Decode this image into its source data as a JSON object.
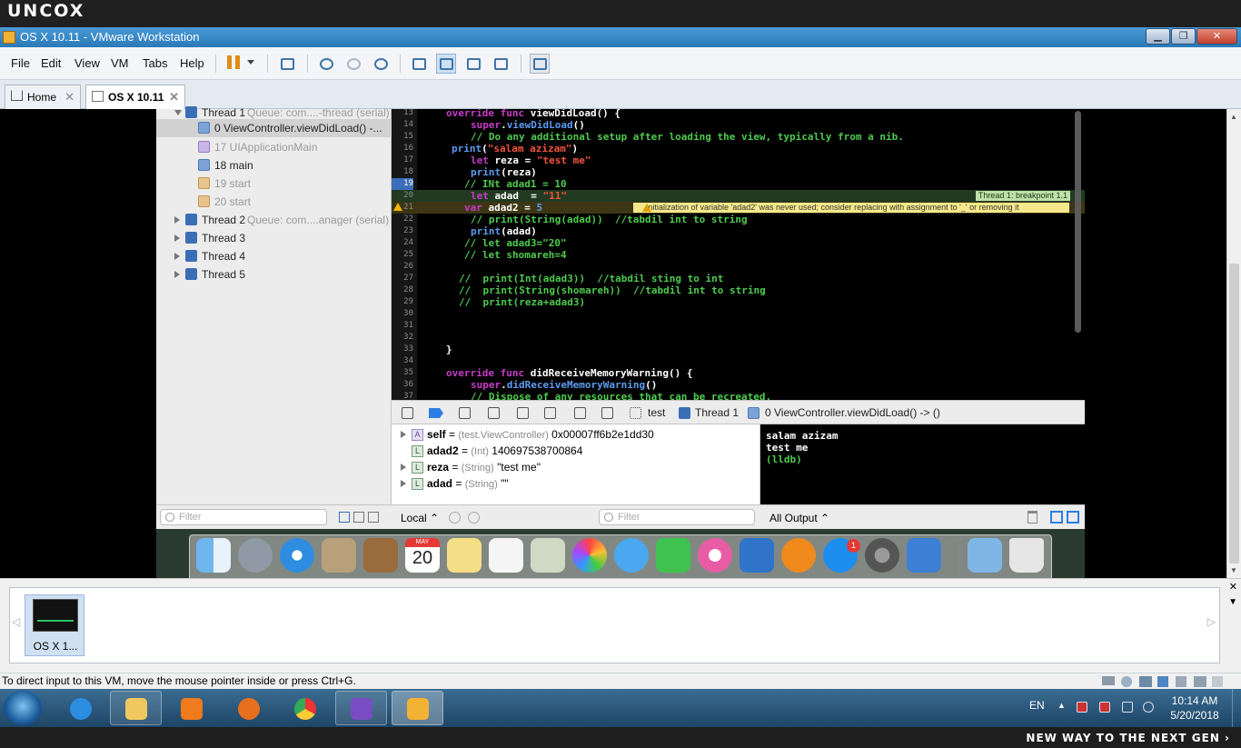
{
  "brand": {
    "top": "UNCOX",
    "bottom": "NEW WAY TO THE NEXT GEN ›"
  },
  "window": {
    "title": "OS X 10.11 - VMware Workstation",
    "minimize": "▁",
    "restore": "❐",
    "close": "✕"
  },
  "menu": [
    "File",
    "Edit",
    "View",
    "VM",
    "Tabs",
    "Help"
  ],
  "tabs": [
    {
      "label": "Home",
      "close": "✕"
    },
    {
      "label": "OS X 10.11",
      "close": "✕"
    }
  ],
  "navigator": {
    "rows": [
      {
        "label": "Thread 1",
        "detail": "Queue: com....-thread (serial)"
      },
      {
        "label": "0 ViewController.viewDidLoad() -..."
      },
      {
        "label": "17 UIApplicationMain"
      },
      {
        "label": "18 main"
      },
      {
        "label": "19 start"
      },
      {
        "label": "20 start"
      },
      {
        "label": "Thread 2",
        "detail": "Queue: com....anager (serial)"
      },
      {
        "label": "Thread 3"
      },
      {
        "label": "Thread 4"
      },
      {
        "label": "Thread 5"
      }
    ],
    "filter_placeholder": "Filter"
  },
  "editor": {
    "line_numbers": [
      "13",
      "14",
      "15",
      "16",
      "17",
      "18",
      "19",
      "20",
      "21",
      "22",
      "23",
      "24",
      "25",
      "26",
      "27",
      "28",
      "29",
      "30",
      "31",
      "32",
      "33",
      "34",
      "35",
      "36",
      "37"
    ],
    "breakpoint_label": "Thread 1: breakpoint 1.1",
    "warning": "Initialization of variable 'adad2' was never used; consider replacing with assignment to '_' or removing it"
  },
  "debugbar": {
    "target": "test",
    "thread": "Thread 1",
    "frame": "0 ViewController.viewDidLoad() -> ()"
  },
  "variables": [
    {
      "name": "self",
      "type": "(test.ViewController)",
      "value": "0x00007ff6b2e1dd30",
      "badge": "A"
    },
    {
      "name": "adad2",
      "type": "(Int)",
      "value": "140697538700864",
      "badge": "L"
    },
    {
      "name": "reza",
      "type": "(String)",
      "value": "\"test me\"",
      "badge": "L"
    },
    {
      "name": "adad",
      "type": "(String)",
      "value": "\"\"",
      "badge": "L"
    }
  ],
  "console": {
    "lines": [
      "salam azizam",
      "test me"
    ],
    "prompt": "(lldb)"
  },
  "panebar": {
    "scope": "Local ⌃",
    "filter_placeholder": "Filter",
    "output": "All Output ⌃"
  },
  "dock": {
    "calendar_month": "MAY",
    "calendar_day": "20",
    "appstore_badge": "1"
  },
  "thumbnail": {
    "label": "OS X 1..."
  },
  "status_text": "To direct input to this VM, move the mouse pointer inside or press Ctrl+G.",
  "taskbar": {
    "lang": "EN",
    "time": "10:14 AM",
    "date": "5/20/2018"
  },
  "colors": {
    "keyword": "#c83ac8",
    "function": "#5c9cf0",
    "comment": "#4ecb4e",
    "string": "#f2553d",
    "breakpoint": "#3a6eb8"
  }
}
